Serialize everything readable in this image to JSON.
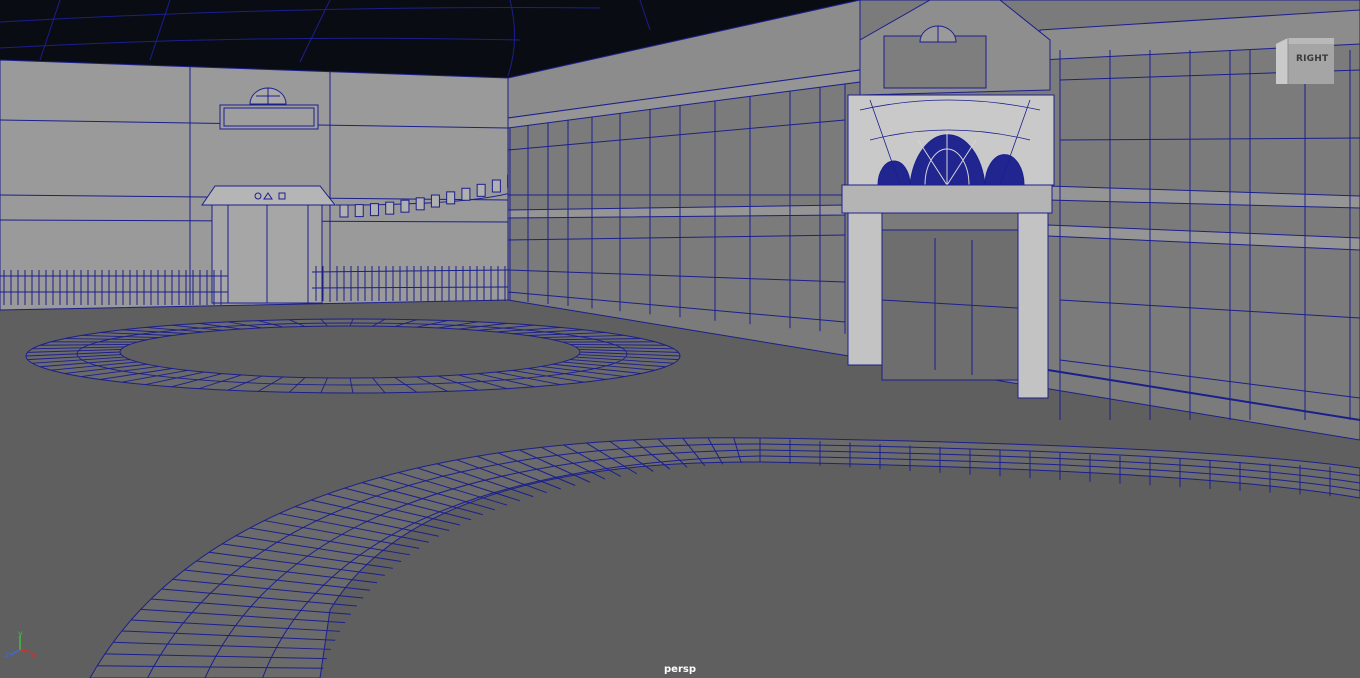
{
  "viewport": {
    "camera_label": "persp",
    "view_cube_label": "RIGHT",
    "axes": {
      "x": "x",
      "y": "y",
      "z": "z"
    },
    "colors": {
      "background_sky": "#0a0c14",
      "ground": "#5f5f5f",
      "wall_light": "#9a9a9a",
      "wall_face": "#8a8a8a",
      "building_face": "#7b7b7b",
      "wireframe": "#1b1f8c",
      "axis_x": "#d23030",
      "axis_y": "#3fbf3f",
      "axis_z": "#3a6bd6"
    }
  }
}
